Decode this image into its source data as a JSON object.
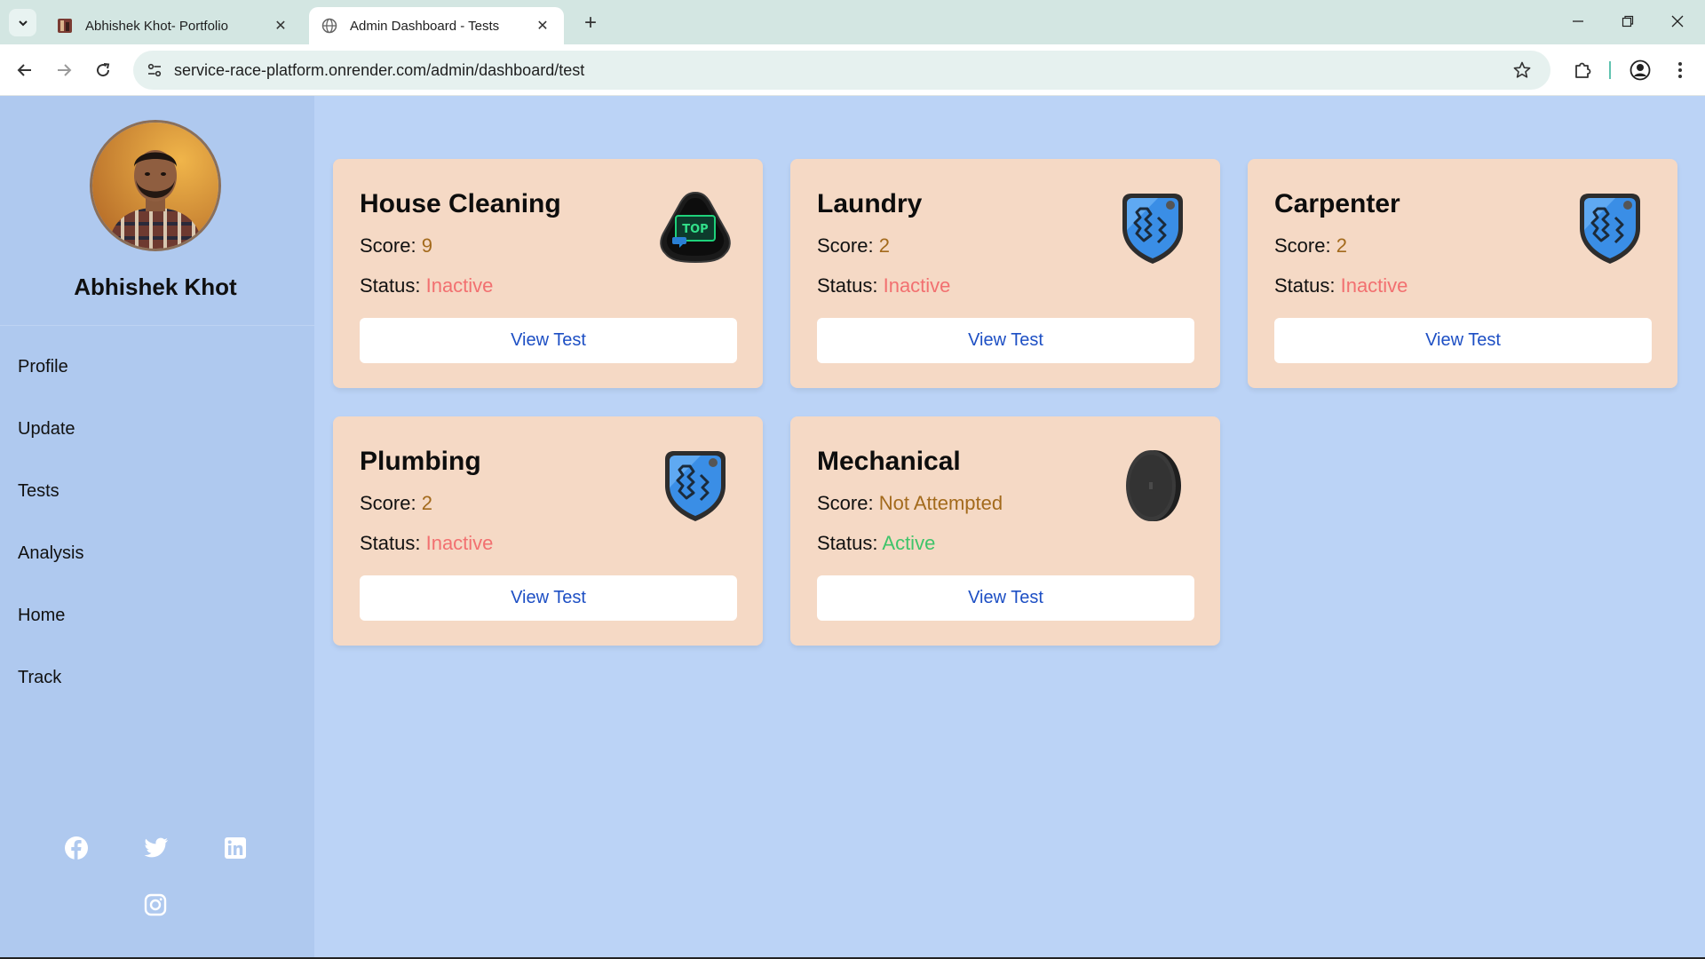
{
  "browser": {
    "tabs": [
      {
        "title": "Abhishek Khot- Portfolio",
        "active": false
      },
      {
        "title": "Admin Dashboard - Tests",
        "active": true
      }
    ],
    "url": "service-race-platform.onrender.com/admin/dashboard/test"
  },
  "sidebar": {
    "user_name": "Abhishek Khot",
    "nav": [
      "Profile",
      "Update",
      "Tests",
      "Analysis",
      "Home",
      "Track"
    ],
    "socials": [
      "facebook-icon",
      "twitter-icon",
      "linkedin-icon",
      "instagram-icon"
    ]
  },
  "labels": {
    "score": "Score: ",
    "status": "Status: ",
    "view_test": "View Test"
  },
  "cards": [
    {
      "title": "House Cleaning",
      "score": "9",
      "status": "Inactive",
      "badge": "top-badge-icon"
    },
    {
      "title": "Laundry",
      "score": "2",
      "status": "Inactive",
      "badge": "shield-badge-icon"
    },
    {
      "title": "Carpenter",
      "score": "2",
      "status": "Inactive",
      "badge": "shield-badge-icon"
    },
    {
      "title": "Plumbing",
      "score": "2",
      "status": "Inactive",
      "badge": "shield-badge-icon"
    },
    {
      "title": "Mechanical",
      "score": "Not Attempted",
      "status": "Active",
      "badge": "locked-coin-badge-icon"
    }
  ],
  "colors": {
    "inactive": "#f27070",
    "active": "#3fc46a",
    "score": "#a36a1c",
    "button_text": "#1d4fc4",
    "card_bg": "#f5d9c5",
    "sidebar_bg": "#afc9ef",
    "main_bg": "#bbd3f6"
  }
}
